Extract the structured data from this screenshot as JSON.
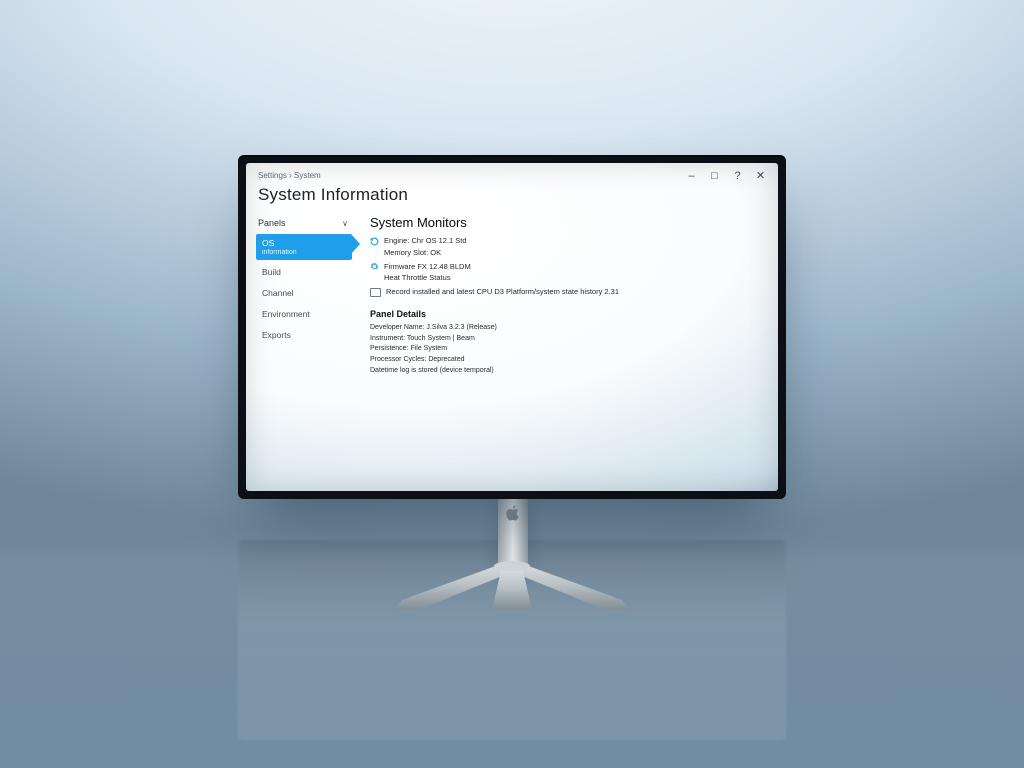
{
  "breadcrumb": "Settings › System",
  "window_title": "System Information",
  "window_controls": {
    "min": "–",
    "max": "□",
    "close": "✕",
    "help": "?"
  },
  "sidebar": {
    "header": "Panels",
    "chevron": "∨",
    "items": [
      {
        "label": "OS",
        "sub": "information",
        "active": true
      },
      {
        "label": "Build",
        "active": false
      },
      {
        "label": "Channel",
        "active": false
      },
      {
        "label": "Environment",
        "active": false
      },
      {
        "label": "Exports",
        "active": false
      }
    ]
  },
  "content": {
    "title": "System Monitors",
    "rows": [
      {
        "icon": "refresh",
        "text": "Engine: Chr OS 12.1 Std"
      },
      {
        "icon": "indent",
        "text": "Memory Slot: OK"
      },
      {
        "icon": "gear",
        "text": "Firmware FX 12.48 BLDM"
      },
      {
        "icon": "indent",
        "text": "Heat Throttle Status"
      },
      {
        "icon": "checkbox",
        "text": "Record installed and latest CPU D3 Platform/system state history 2.31"
      }
    ],
    "section_title": "Panel Details",
    "details": [
      "Developer Name: J.Silva 3.2.3 (Release)",
      "Instrument: Touch System | Beam",
      "Persistence: File System",
      "Processor Cycles: Deprecated",
      "Datetime log is stored (device temporal)"
    ]
  }
}
